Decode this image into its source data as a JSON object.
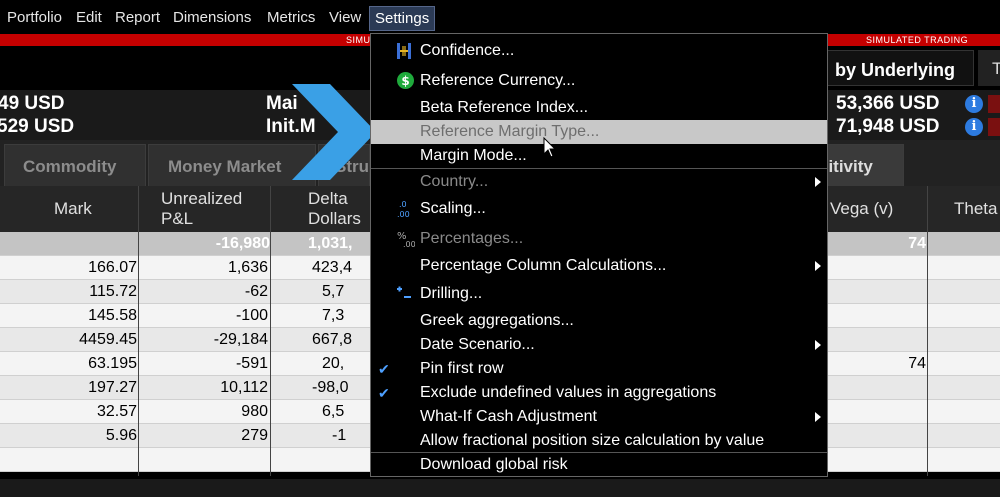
{
  "menubar": {
    "items": [
      "Portfolio",
      "Edit",
      "Report",
      "Dimensions",
      "Metrics",
      "View",
      "Settings"
    ],
    "active": "Settings"
  },
  "banner": {
    "left": "SIMU",
    "right": "SIMULATED TRADING"
  },
  "view_tabs": {
    "by_underlying": "by Underlying",
    "next": "T"
  },
  "account": {
    "left_values": [
      "49 USD",
      "529 USD"
    ],
    "middle_labels": [
      "Mai",
      "Init.M"
    ],
    "right_values": [
      "53,366 USD",
      "71,948 USD"
    ]
  },
  "tabs": [
    "Commodity",
    "Money Market",
    "Stru",
    "sitivity"
  ],
  "table": {
    "headers": {
      "mark": "Mark",
      "unrealized_1": "Unrealized",
      "unrealized_2": "P&L",
      "delta_1": "Delta",
      "delta_2": "Dollars",
      "vega": "Vega (v)",
      "theta": "Theta"
    },
    "summary_row": {
      "unrealized": "-16,980",
      "delta": "1,031,",
      "vega": "74"
    },
    "rows": [
      {
        "mark": "166.07",
        "unrealized": "1,636",
        "delta": "423,4",
        "vega": ""
      },
      {
        "mark": "115.72",
        "unrealized": "-62",
        "delta": "5,7",
        "vega": ""
      },
      {
        "mark": "145.58",
        "unrealized": "-100",
        "delta": "7,3",
        "vega": ""
      },
      {
        "mark": "4459.45",
        "unrealized": "-29,184",
        "delta": "667,8",
        "vega": ""
      },
      {
        "mark": "63.195",
        "unrealized": "-591",
        "delta": "20,",
        "vega": "74"
      },
      {
        "mark": "197.27",
        "unrealized": "10,112",
        "delta": "-98,0",
        "vega": ""
      },
      {
        "mark": "32.57",
        "unrealized": "980",
        "delta": "6,5",
        "vega": ""
      },
      {
        "mark": "5.96",
        "unrealized": "279",
        "delta": "-1",
        "vega": ""
      }
    ]
  },
  "settings_menu": {
    "items": [
      {
        "label": "Confidence...",
        "icon": "confidence-icon"
      },
      {
        "label": "Reference Currency...",
        "icon": "dollar-icon"
      },
      {
        "label": "Beta Reference Index..."
      },
      {
        "label": "Reference Margin Type...",
        "state": "highlighted-disabled"
      },
      {
        "label": "Margin Mode..."
      },
      {
        "label": "Country...",
        "state": "disabled",
        "submenu": true
      },
      {
        "label": "Scaling...",
        "icon": "scaling-icon"
      },
      {
        "label": "Percentages...",
        "icon": "percentages-icon",
        "state": "disabled"
      },
      {
        "label": "Percentage Column Calculations...",
        "submenu": true
      },
      {
        "label": "Drilling...",
        "icon": "drilling-icon"
      },
      {
        "label": "Greek aggregations..."
      },
      {
        "label": "Date Scenario...",
        "submenu": true
      },
      {
        "label": "Pin first row",
        "checked": true
      },
      {
        "label": "Exclude undefined values in aggregations",
        "checked": true
      },
      {
        "label": "What-If Cash Adjustment",
        "submenu": true
      },
      {
        "label": "Allow fractional position size calculation by value"
      },
      {
        "label": "Download global risk"
      }
    ]
  },
  "colors": {
    "menu_bg": "#000000",
    "highlight": "#c8c8c8",
    "accent_blue": "#4ea0ff",
    "banner_red": "#c40000",
    "chevron": "#3aa0e6"
  }
}
